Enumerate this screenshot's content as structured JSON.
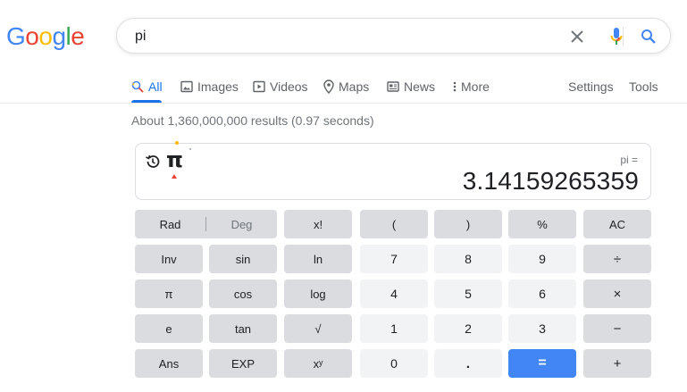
{
  "logo": {
    "letters": [
      "G",
      "o",
      "o",
      "g",
      "l",
      "e"
    ],
    "colors": [
      "#4285f4",
      "#ea4335",
      "#fbbc05",
      "#4285f4",
      "#34a853",
      "#ea4335"
    ]
  },
  "search": {
    "value": "pi"
  },
  "tabs": [
    {
      "label": "All",
      "icon": "search-icon"
    },
    {
      "label": "Images",
      "icon": "image-icon"
    },
    {
      "label": "Videos",
      "icon": "play-icon"
    },
    {
      "label": "Maps",
      "icon": "location-pin-icon"
    },
    {
      "label": "News",
      "icon": "newspaper-icon"
    },
    {
      "label": "More",
      "icon": "more-vert-icon"
    }
  ],
  "tools": {
    "settings": "Settings",
    "tools": "Tools"
  },
  "stats": "About 1,360,000,000 results (0.97 seconds)",
  "calculator": {
    "symbol": "π",
    "expression": "pi =",
    "result": "3.14159265359",
    "rad": "Rad",
    "deg": "Deg",
    "keys": {
      "fact": "x!",
      "lparen": "(",
      "rparen": ")",
      "percent": "%",
      "ac": "AC",
      "inv": "Inv",
      "sin": "sin",
      "ln": "ln",
      "seven": "7",
      "eight": "8",
      "nine": "9",
      "div": "÷",
      "pi": "π",
      "cos": "cos",
      "log": "log",
      "four": "4",
      "five": "5",
      "six": "6",
      "mul": "×",
      "e": "e",
      "tan": "tan",
      "sqrt": "√",
      "one": "1",
      "two": "2",
      "three": "3",
      "minus": "−",
      "ans": "Ans",
      "exp": "EXP",
      "pow": "xʸ",
      "zero": "0",
      "dot": ".",
      "eq": "=",
      "plus": "+"
    },
    "accent": "#4285f4"
  }
}
